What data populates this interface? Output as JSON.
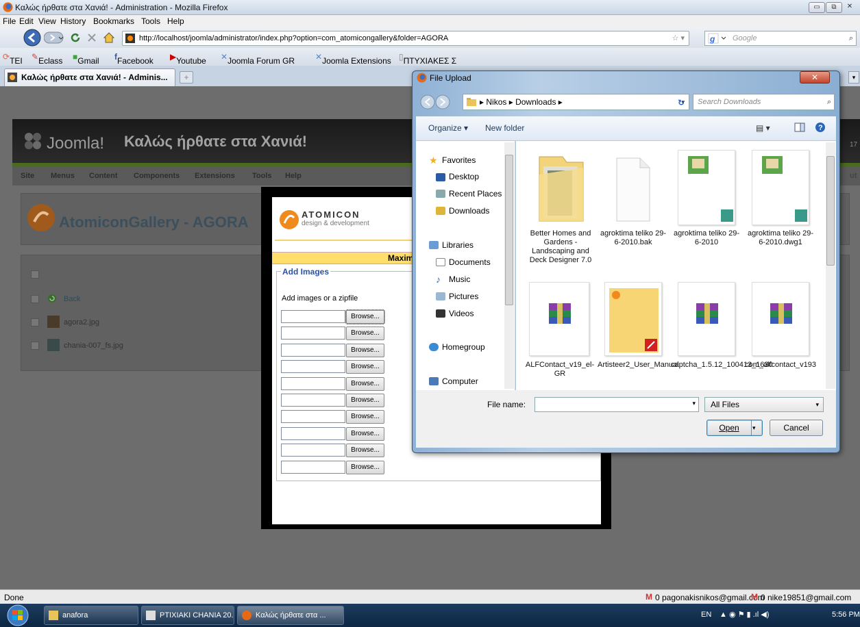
{
  "browser": {
    "window_title": "Καλώς ήρθατε στα Χανιά! - Administration - Mozilla Firefox",
    "menu": [
      "File",
      "Edit",
      "View",
      "History",
      "Bookmarks",
      "Tools",
      "Help"
    ],
    "url": "http://localhost/joomla/administrator/index.php?option=com_atomicongallery&folder=AGORA",
    "search_placeholder": "Google",
    "bookmarks": [
      "TEI",
      "Eclass",
      "Gmail",
      "Facebook",
      "Youtube",
      "Joomla Forum GR",
      "Joomla Extensions",
      "ΠΤΥΧΙΑΚΕΣ Σ"
    ],
    "tab_title": "Καλώς ήρθατε στα Χανιά! - Adminis...",
    "status": "Done",
    "status_right": [
      "0 pagonakisnikos@gmail.com",
      "0 nike19851@gmail.com"
    ]
  },
  "joomla": {
    "logo": "Joomla!",
    "site_name": "Καλώς ήρθατε στα Χανιά!",
    "menu": [
      "Site",
      "Menus",
      "Content",
      "Components",
      "Extensions",
      "Tools",
      "Help"
    ],
    "page_title": "AtomiconGallery - AGORA",
    "rows": [
      "Back",
      "agora2.jpg",
      "chania-007_fs.jpg"
    ],
    "right_edge_text": [
      "17",
      "ut"
    ]
  },
  "atomicon": {
    "brand": "ATOMICON",
    "tagline": "design & development",
    "bar_text": "Maxim",
    "legend": "Add Images",
    "label": "Add images or a zipfile",
    "browse_label": "Browse...",
    "browse_count": 10
  },
  "dialog": {
    "title": "File Upload",
    "path": [
      "Nikos",
      "Downloads"
    ],
    "search_placeholder": "Search Downloads",
    "organize": "Organize",
    "new_folder": "New folder",
    "nav": {
      "favorites": "Favorites",
      "desktop": "Desktop",
      "recent": "Recent Places",
      "downloads": "Downloads",
      "libraries": "Libraries",
      "documents": "Documents",
      "music": "Music",
      "pictures": "Pictures",
      "videos": "Videos",
      "homegroup": "Homegroup",
      "computer": "Computer"
    },
    "files": [
      "Better Homes and Gardens - Landscaping and Deck Designer 7.0",
      "agroktima teliko 29-6-2010.bak",
      "agroktima teliko 29-6-2010",
      "agroktima teliko 29-6-2010.dwg1",
      "ALFContact_v19_el-GR",
      "Artisteer2_User_Manual",
      "captcha_1.5.12_100413_1630",
      "com_alfcontact_v193"
    ],
    "file_name_label": "File name:",
    "file_type": "All Files",
    "open": "Open",
    "cancel": "Cancel"
  },
  "taskbar": {
    "items": [
      "anafora",
      "PTIXIAKI CHANIA 20...",
      "Καλώς ήρθατε στα ..."
    ],
    "lang": "EN",
    "time": "5:56 PM"
  },
  "colors": {
    "joomla_green": "#4a6b1f",
    "atomicon_yellow": "#ffde6b",
    "legend_blue": "#2a52a8",
    "dialog_frame": "#a6c1de"
  }
}
